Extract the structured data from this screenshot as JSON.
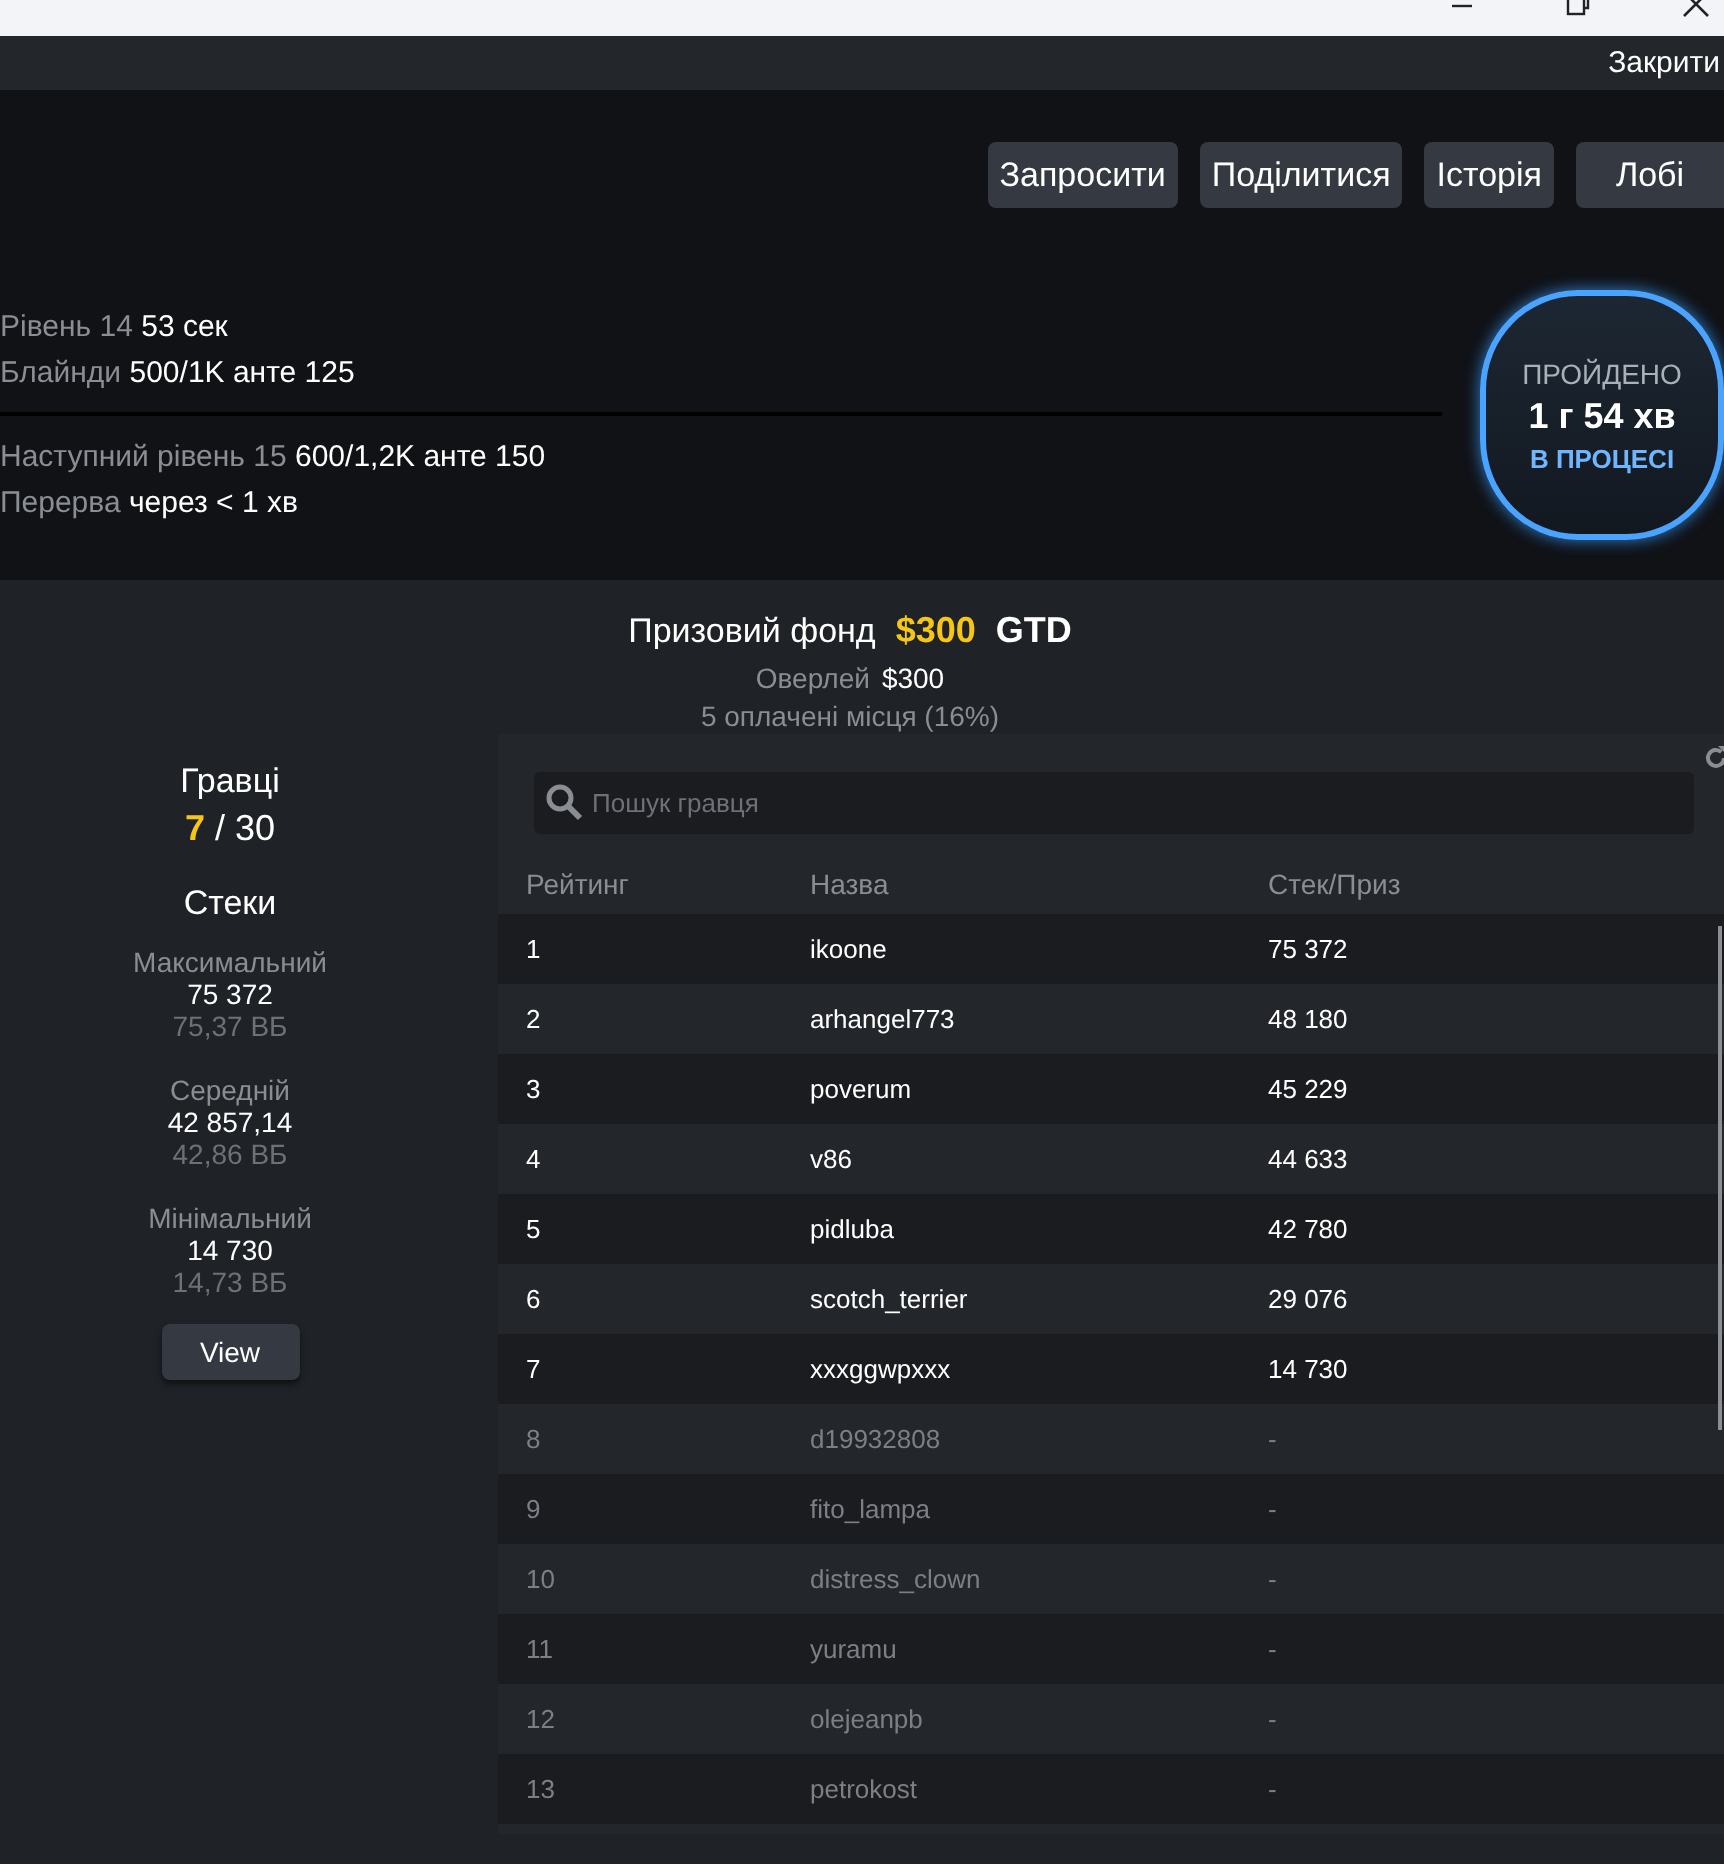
{
  "top_bar": {
    "close_label": "Закрити"
  },
  "actions": [
    {
      "label": "Запросити"
    },
    {
      "label": "Поділитися"
    },
    {
      "label": "Історія"
    },
    {
      "label": "Лобі"
    }
  ],
  "level_info": {
    "current": [
      {
        "label": "Рівень 14",
        "value": "53 сек"
      },
      {
        "label": "Блайнди",
        "value": "500/1K анте 125"
      }
    ],
    "next": [
      {
        "label": "Наступний рівень 15",
        "value": "600/1,2K анте 150"
      },
      {
        "label": "Перерва",
        "value": "через < 1 хв"
      }
    ]
  },
  "badge": {
    "title": "ПРОЙДЕНО",
    "time": "1 г 54 хв",
    "status": "В ПРОЦЕСІ"
  },
  "prize": {
    "label": "Призовий фонд",
    "amount": "$300",
    "suffix": "GTD",
    "overlay_label": "Оверлей",
    "overlay_value": "$300",
    "paid": "5 оплачені місця (16%)"
  },
  "players": {
    "title": "Гравці",
    "count": "7",
    "total": "/ 30"
  },
  "stacks": {
    "title": "Стеки",
    "items": [
      {
        "label": "Максимальний",
        "value": "75 372",
        "bb": "75,37 ВБ"
      },
      {
        "label": "Середній",
        "value": "42 857,14",
        "bb": "42,86 ВБ"
      },
      {
        "label": "Мінімальний",
        "value": "14 730",
        "bb": "14,73 ВБ"
      }
    ],
    "button": "View"
  },
  "table": {
    "search": {
      "placeholder": "Пошук гравця"
    },
    "columns": [
      "Рейтинг",
      "Назва",
      "Стек/Приз"
    ],
    "rows": [
      {
        "rank": "1",
        "name": "ikoone",
        "stack": "75 372",
        "eliminated": false
      },
      {
        "rank": "2",
        "name": "arhangel773",
        "stack": "48 180",
        "eliminated": false
      },
      {
        "rank": "3",
        "name": "poverum",
        "stack": "45 229",
        "eliminated": false
      },
      {
        "rank": "4",
        "name": "v86",
        "stack": "44 633",
        "eliminated": false
      },
      {
        "rank": "5",
        "name": "pidluba",
        "stack": "42 780",
        "eliminated": false
      },
      {
        "rank": "6",
        "name": "scotch_terrier",
        "stack": "29 076",
        "eliminated": false
      },
      {
        "rank": "7",
        "name": "xxxggwpxxx",
        "stack": "14 730",
        "eliminated": false
      },
      {
        "rank": "8",
        "name": "d19932808",
        "stack": "-",
        "eliminated": true
      },
      {
        "rank": "9",
        "name": "fito_lampa",
        "stack": "-",
        "eliminated": true
      },
      {
        "rank": "10",
        "name": "distress_clown",
        "stack": "-",
        "eliminated": true
      },
      {
        "rank": "11",
        "name": "yuramu",
        "stack": "-",
        "eliminated": true
      },
      {
        "rank": "12",
        "name": "olejeanpb",
        "stack": "-",
        "eliminated": true
      },
      {
        "rank": "13",
        "name": "petrokost",
        "stack": "-",
        "eliminated": true
      }
    ]
  }
}
